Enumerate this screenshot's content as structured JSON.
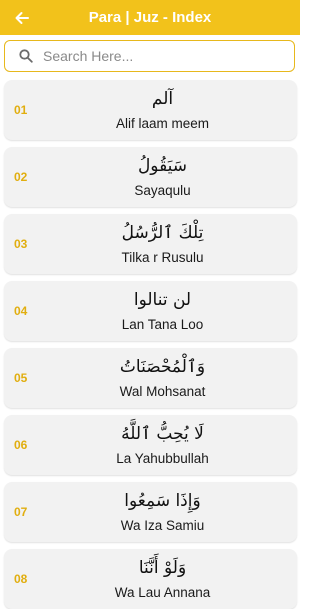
{
  "appbar": {
    "title": "Para | Juz - Index",
    "back_icon": "arrow-left-icon"
  },
  "search": {
    "placeholder": "Search Here...",
    "value": "",
    "icon": "search-icon"
  },
  "colors": {
    "accent": "#F2C21B",
    "number": "#E1AE0F",
    "card": "#F2F2F2"
  },
  "paras": [
    {
      "number": "01",
      "arabic": "آلم",
      "name": "Alif laam meem"
    },
    {
      "number": "02",
      "arabic": "سَيَقُولُ",
      "name": "Sayaqulu"
    },
    {
      "number": "03",
      "arabic": "تِلْكَ ٱلرُّسُلُ",
      "name": "Tilka r Rusulu"
    },
    {
      "number": "04",
      "arabic": "لن تنالوا",
      "name": "Lan Tana Loo"
    },
    {
      "number": "05",
      "arabic": "وَٱلْمُحْصَنَاتُ",
      "name": "Wal Mohsanat"
    },
    {
      "number": "06",
      "arabic": "لَا يُحِبُّ ٱللَّهُ",
      "name": "La Yahubbullah"
    },
    {
      "number": "07",
      "arabic": "وَإِذَا سَمِعُوا",
      "name": "Wa Iza Samiu"
    },
    {
      "number": "08",
      "arabic": "وَلَوْ أَنَّنَا",
      "name": "Wa Lau Annana"
    }
  ]
}
